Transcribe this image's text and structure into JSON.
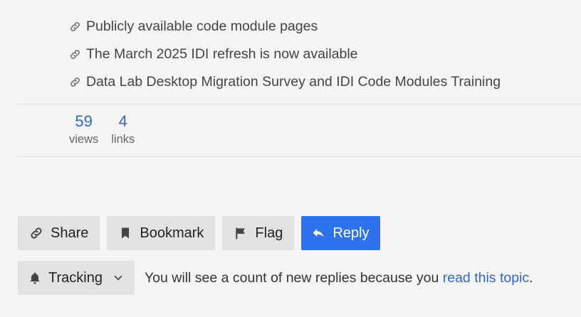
{
  "linked_topics": [
    {
      "label": "Publicly available code module pages",
      "icon": "link-icon"
    },
    {
      "label": "The March 2025 IDI refresh is now available",
      "icon": "link-icon"
    },
    {
      "label": "Data Lab Desktop Migration Survey and IDI Code Modules Training",
      "icon": "link-icon"
    }
  ],
  "stats": {
    "views": {
      "value": "59",
      "label": "views"
    },
    "links": {
      "value": "4",
      "label": "links"
    }
  },
  "actions": {
    "share_label": "Share",
    "bookmark_label": "Bookmark",
    "flag_label": "Flag",
    "reply_label": "Reply"
  },
  "tracking": {
    "level_label": "Tracking",
    "message_prefix": "You will see a count of new replies because you ",
    "message_link": "read this topic",
    "message_suffix": "."
  },
  "colors": {
    "accent": "#2f72f0",
    "link": "#3565c4",
    "button_bg": "#e2e2e2",
    "page_bg": "#f5f5f5"
  }
}
